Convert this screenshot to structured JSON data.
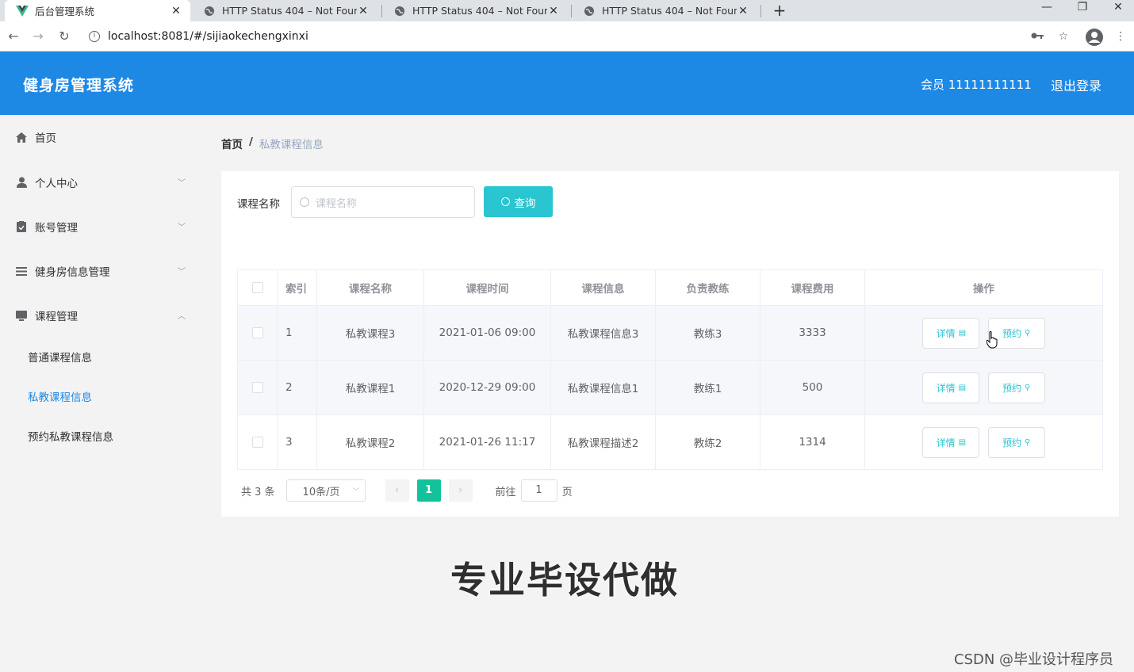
{
  "browser": {
    "tabs": [
      {
        "title": "后台管理系统",
        "active": true
      },
      {
        "title": "HTTP Status 404 – Not Found",
        "active": false
      },
      {
        "title": "HTTP Status 404 – Not Found",
        "active": false
      },
      {
        "title": "HTTP Status 404 – Not Found",
        "active": false
      }
    ],
    "url": "localhost:8081/#/sijiaokechengxinxi"
  },
  "header": {
    "title": "健身房管理系统",
    "user": "会员 11111111111",
    "logout": "退出登录",
    "brand_color": "#1e88e5"
  },
  "sidebar": {
    "items": [
      {
        "label": "首页",
        "icon": "home-icon"
      },
      {
        "label": "个人中心",
        "icon": "user-icon",
        "arrow": "down"
      },
      {
        "label": "账号管理",
        "icon": "clipboard-icon",
        "arrow": "down"
      },
      {
        "label": "健身房信息管理",
        "icon": "list-icon",
        "arrow": "down"
      },
      {
        "label": "课程管理",
        "icon": "monitor-icon",
        "arrow": "up"
      }
    ],
    "subitems": [
      {
        "label": "普通课程信息",
        "active": false
      },
      {
        "label": "私教课程信息",
        "active": true
      },
      {
        "label": "预约私教课程信息",
        "active": false
      }
    ]
  },
  "breadcrumb": {
    "home": "首页",
    "sep": "/",
    "current": "私教课程信息"
  },
  "search": {
    "label": "课程名称",
    "placeholder": "课程名称",
    "button": "查询",
    "accent": "#29c5d1"
  },
  "table": {
    "headers": [
      "索引",
      "课程名称",
      "课程时间",
      "课程信息",
      "负责教练",
      "课程费用",
      "操作"
    ],
    "rows": [
      {
        "index": "1",
        "name": "私教课程3",
        "time": "2021-01-06 09:00",
        "info": "私教课程信息3",
        "coach": "教练3",
        "fee": "3333"
      },
      {
        "index": "2",
        "name": "私教课程1",
        "time": "2020-12-29 09:00",
        "info": "私教课程信息1",
        "coach": "教练1",
        "fee": "500"
      },
      {
        "index": "3",
        "name": "私教课程2",
        "time": "2021-01-26 11:17",
        "info": "私教课程描述2",
        "coach": "教练2",
        "fee": "1314"
      }
    ],
    "detail_label": "详情",
    "book_label": "预约"
  },
  "pager": {
    "total": "共 3 条",
    "page_size": "10条/页",
    "current_page": "1",
    "goto_label": "前往",
    "goto_value": "1",
    "page_suffix": "页",
    "active_color": "#13c29b"
  },
  "overlay": {
    "watermark": "专业毕设代做",
    "credit": "CSDN @毕业设计程序员"
  }
}
